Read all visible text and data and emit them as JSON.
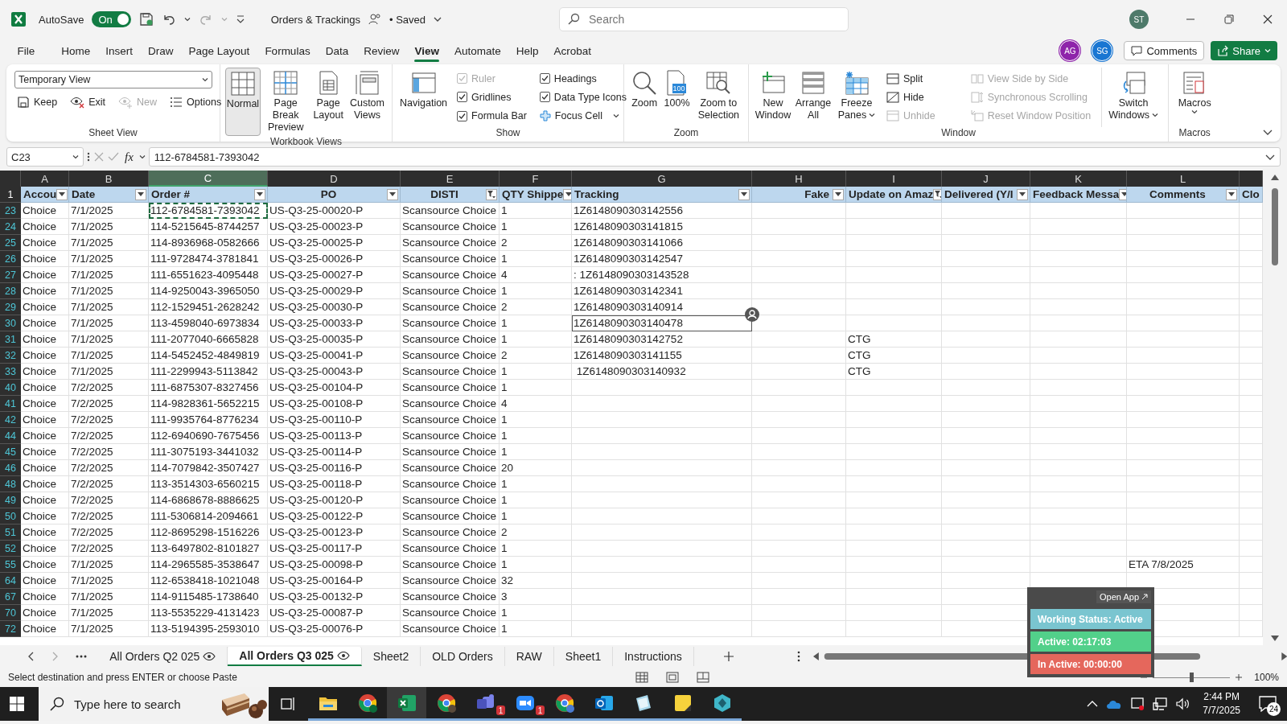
{
  "title_bar": {
    "autosave_label": "AutoSave",
    "autosave": {
      "label": "On",
      "on": true
    },
    "document_title": "Orders & Trackings",
    "save_status": "• Saved",
    "search_placeholder": "Search",
    "user_initials": "ST"
  },
  "menu_tabs": [
    {
      "label": "File",
      "selected": false
    },
    {
      "label": "Home",
      "selected": false
    },
    {
      "label": "Insert",
      "selected": false
    },
    {
      "label": "Draw",
      "selected": false
    },
    {
      "label": "Page Layout",
      "selected": false
    },
    {
      "label": "Formulas",
      "selected": false
    },
    {
      "label": "Data",
      "selected": false
    },
    {
      "label": "Review",
      "selected": false
    },
    {
      "label": "View",
      "selected": true
    },
    {
      "label": "Automate",
      "selected": false
    },
    {
      "label": "Help",
      "selected": false
    },
    {
      "label": "Acrobat",
      "selected": false
    }
  ],
  "collaborators": [
    {
      "initials": "AG",
      "color": "#8e24aa"
    },
    {
      "initials": "SG",
      "color": "#1976d2"
    }
  ],
  "comments_button": "Comments",
  "share_button": "Share",
  "ribbon": {
    "sheet_view": {
      "label": "Sheet View",
      "view": "Temporary View",
      "buttons": [
        {
          "label": "Keep",
          "disabled": false
        },
        {
          "label": "Exit",
          "disabled": false
        },
        {
          "label": "New",
          "disabled": true
        },
        {
          "label": "Options",
          "disabled": false
        }
      ]
    },
    "workbook_views": {
      "label": "Workbook Views",
      "buttons": [
        {
          "label": "Normal",
          "selected": true
        },
        {
          "label": "Page Break Preview",
          "selected": false
        },
        {
          "label": "Page Layout",
          "selected": false
        },
        {
          "label": "Custom Views",
          "selected": false
        }
      ]
    },
    "show": {
      "label": "Show",
      "navigation": "Navigation",
      "checks": [
        {
          "label": "Ruler",
          "checked": true,
          "disabled": true
        },
        {
          "label": "Gridlines",
          "checked": true,
          "disabled": false
        },
        {
          "label": "Formula Bar",
          "checked": true,
          "disabled": false
        },
        {
          "label": "Headings",
          "checked": true,
          "disabled": false
        },
        {
          "label": "Data Type Icons",
          "checked": true,
          "disabled": false
        }
      ],
      "focus_cell": "Focus Cell"
    },
    "zoom": {
      "label": "Zoom",
      "buttons": [
        {
          "label": "Zoom"
        },
        {
          "label": "100%",
          "badge": "100"
        },
        {
          "label": "Zoom to Selection"
        }
      ]
    },
    "window": {
      "label": "Window",
      "large": [
        {
          "label": "New Window",
          "dropdown": false
        },
        {
          "label": "Arrange All",
          "dropdown": false
        },
        {
          "label": "Freeze Panes",
          "dropdown": true
        }
      ],
      "small": [
        {
          "label": "Split",
          "disabled": false
        },
        {
          "label": "Hide",
          "disabled": false
        },
        {
          "label": "Unhide",
          "disabled": true
        }
      ],
      "side": [
        {
          "label": "View Side by Side",
          "disabled": true
        },
        {
          "label": "Synchronous Scrolling",
          "disabled": true
        },
        {
          "label": "Reset Window Position",
          "disabled": true
        }
      ],
      "switch": {
        "label": "Switch Windows",
        "dropdown": true
      }
    },
    "macros": {
      "label": "Macros",
      "button": {
        "label": "Macros",
        "dropdown": true
      }
    }
  },
  "formula_bar": {
    "name_box": "C23",
    "fx": "fx",
    "formula": "112-6784581-7393042"
  },
  "columns": [
    {
      "letter": "A",
      "header": "Accou",
      "filtered": false,
      "selected": false
    },
    {
      "letter": "B",
      "header": "Date",
      "filtered": false,
      "selected": false
    },
    {
      "letter": "C",
      "header": "Order #",
      "filtered": false,
      "selected": true
    },
    {
      "letter": "D",
      "header": "PO",
      "filtered": false,
      "selected": false
    },
    {
      "letter": "E",
      "header": "DISTI",
      "filtered": true,
      "selected": false
    },
    {
      "letter": "F",
      "header": "QTY Shippe",
      "filtered": false,
      "selected": false
    },
    {
      "letter": "G",
      "header": "Tracking",
      "filtered": false,
      "selected": false
    },
    {
      "letter": "H",
      "header": "Fake",
      "filtered": false,
      "selected": false
    },
    {
      "letter": "I",
      "header": "Update on Amaz",
      "filtered": true,
      "selected": false
    },
    {
      "letter": "J",
      "header": "Delivered (Y/I",
      "filtered": false,
      "selected": false
    },
    {
      "letter": "K",
      "header": "Feedback Messa",
      "filtered": false,
      "selected": false
    },
    {
      "letter": "L",
      "header": "Comments",
      "filtered": false,
      "selected": false
    },
    {
      "header": "Clo",
      "selected": false
    }
  ],
  "header_row_number": "1",
  "rows": [
    {
      "number": "23",
      "cells": [
        "Choice",
        "7/1/2025",
        {
          "text": "112-6784581-7393042",
          "copied": true
        },
        "US-Q3-25-00020-P",
        "Scansource Choice",
        "1",
        "1Z6148090303142556"
      ]
    },
    {
      "number": "24",
      "cells": [
        "Choice",
        "7/1/2025",
        "114-5215645-8744257",
        "US-Q3-25-00023-P",
        "Scansource Choice",
        "1",
        "1Z6148090303141815"
      ]
    },
    {
      "number": "25",
      "cells": [
        "Choice",
        "7/1/2025",
        "114-8936968-0582666",
        "US-Q3-25-00025-P",
        "Scansource Choice",
        "2",
        "1Z6148090303141066"
      ]
    },
    {
      "number": "26",
      "cells": [
        "Choice",
        "7/1/2025",
        "111-9728474-3781841",
        "US-Q3-25-00026-P",
        "Scansource Choice",
        "1",
        "1Z6148090303142547"
      ]
    },
    {
      "number": "27",
      "cells": [
        "Choice",
        "7/1/2025",
        "111-6551623-4095448",
        "US-Q3-25-00027-P",
        "Scansource Choice",
        "4",
        ": 1Z6148090303143528"
      ]
    },
    {
      "number": "28",
      "cells": [
        "Choice",
        "7/1/2025",
        "114-9250043-3965050",
        "US-Q3-25-00029-P",
        "Scansource Choice",
        "1",
        "1Z6148090303142341"
      ]
    },
    {
      "number": "29",
      "cells": [
        "Choice",
        "7/1/2025",
        "112-1529451-2628242",
        "US-Q3-25-00030-P",
        "Scansource Choice",
        "2",
        "1Z6148090303140914"
      ]
    },
    {
      "number": "30",
      "cells": [
        "Choice",
        "7/1/2025",
        "113-4598040-6973834",
        "US-Q3-25-00033-P",
        "Scansource Choice",
        "1",
        {
          "text": "1Z6148090303140478",
          "coauthor_selected": true
        }
      ]
    },
    {
      "number": "31",
      "cells": [
        "Choice",
        "7/1/2025",
        "111-2077040-6665828",
        "US-Q3-25-00035-P",
        "Scansource Choice",
        "1",
        "1Z6148090303142752",
        null,
        "CTG"
      ]
    },
    {
      "number": "32",
      "cells": [
        "Choice",
        "7/1/2025",
        "114-5452452-4849819",
        "US-Q3-25-00041-P",
        "Scansource Choice",
        "2",
        "1Z6148090303141155",
        null,
        "CTG"
      ]
    },
    {
      "number": "33",
      "cells": [
        "Choice",
        "7/1/2025",
        "111-2299943-5113842",
        "US-Q3-25-00043-P",
        "Scansource Choice",
        "1",
        " 1Z6148090303140932",
        null,
        "CTG"
      ]
    },
    {
      "number": "40",
      "cells": [
        "Choice",
        "7/2/2025",
        "111-6875307-8327456",
        "US-Q3-25-00104-P",
        "Scansource Choice",
        "1"
      ]
    },
    {
      "number": "41",
      "cells": [
        "Choice",
        "7/2/2025",
        "114-9828361-5652215",
        "US-Q3-25-00108-P",
        "Scansource Choice",
        "4"
      ]
    },
    {
      "number": "42",
      "cells": [
        "Choice",
        "7/2/2025",
        "111-9935764-8776234",
        "US-Q3-25-00110-P",
        "Scansource Choice",
        "1"
      ]
    },
    {
      "number": "44",
      "cells": [
        "Choice",
        "7/2/2025",
        "112-6940690-7675456",
        "US-Q3-25-00113-P",
        "Scansource Choice",
        "1"
      ]
    },
    {
      "number": "45",
      "cells": [
        "Choice",
        "7/2/2025",
        "111-3075193-3441032",
        "US-Q3-25-00114-P",
        "Scansource Choice",
        "1"
      ]
    },
    {
      "number": "46",
      "cells": [
        "Choice",
        "7/2/2025",
        "114-7079842-3507427",
        "US-Q3-25-00116-P",
        "Scansource Choice",
        "20"
      ]
    },
    {
      "number": "48",
      "cells": [
        "Choice",
        "7/2/2025",
        "113-3514303-6560215",
        "US-Q3-25-00118-P",
        "Scansource Choice",
        "1"
      ]
    },
    {
      "number": "49",
      "cells": [
        "Choice",
        "7/2/2025",
        "114-6868678-8886625",
        "US-Q3-25-00120-P",
        "Scansource Choice",
        "1"
      ]
    },
    {
      "number": "50",
      "cells": [
        "Choice",
        "7/2/2025",
        "111-5306814-2094661",
        "US-Q3-25-00122-P",
        "Scansource Choice",
        "1"
      ]
    },
    {
      "number": "51",
      "cells": [
        "Choice",
        "7/2/2025",
        "112-8695298-1516226",
        "US-Q3-25-00123-P",
        "Scansource Choice",
        "2"
      ]
    },
    {
      "number": "52",
      "cells": [
        "Choice",
        "7/2/2025",
        "113-6497802-8101827",
        "US-Q3-25-00117-P",
        "Scansource Choice",
        "1"
      ]
    },
    {
      "number": "55",
      "cells": [
        "Choice",
        "7/1/2025",
        "114-2965585-3538647",
        "US-Q3-25-00098-P",
        "Scansource Choice",
        "1",
        null,
        null,
        null,
        null,
        null,
        "ETA 7/8/2025"
      ]
    },
    {
      "number": "64",
      "cells": [
        "Choice",
        "7/1/2025",
        "112-6538418-1021048",
        "US-Q3-25-00164-P",
        "Scansource Choice",
        "32"
      ]
    },
    {
      "number": "67",
      "cells": [
        "Choice",
        "7/1/2025",
        "114-9115485-1738640",
        "US-Q3-25-00132-P",
        "Scansource Choice",
        "3"
      ]
    },
    {
      "number": "70",
      "cells": [
        "Choice",
        "7/1/2025",
        "113-5535229-4131423",
        "US-Q3-25-00087-P",
        "Scansource Choice",
        "1"
      ]
    },
    {
      "number": "72",
      "cells": [
        "Choice",
        "7/1/2025",
        "113-5194395-2593010",
        "US-Q3-25-00076-P",
        "Scansource Choice",
        "1"
      ]
    }
  ],
  "sheet_tabs": [
    {
      "label": "All Orders Q2 025",
      "selected": false,
      "watched": true
    },
    {
      "label": "All Orders Q3 025",
      "selected": true,
      "watched": true
    },
    {
      "label": "Sheet2",
      "selected": false,
      "watched": false
    },
    {
      "label": "OLD Orders",
      "selected": false,
      "watched": false
    },
    {
      "label": "RAW",
      "selected": false,
      "watched": false
    },
    {
      "label": "Sheet1",
      "selected": false,
      "watched": false
    },
    {
      "label": "Instructions",
      "selected": false,
      "watched": false
    }
  ],
  "status_bar": {
    "message": "Select destination and press ENTER or choose Paste",
    "zoom_slider": {
      "level": 0.5
    },
    "zoom": "100%"
  },
  "tracker_widget": {
    "open_app": "Open App",
    "statuses": [
      {
        "label": "Working Status: Active",
        "color": "#7ac5d0"
      },
      {
        "label": "Active: 02:17:03",
        "color": "#52d08a"
      },
      {
        "label": "In Active: 00:00:00",
        "color": "#e5675c"
      }
    ]
  },
  "taskbar": {
    "search_placeholder": "Type here to search",
    "apps": [
      {
        "running": false,
        "active": false
      },
      {
        "running": true,
        "active": false
      },
      {
        "running": true,
        "active": false
      },
      {
        "running": true,
        "active": true
      },
      {
        "running": true,
        "active": false
      },
      {
        "running": true,
        "active": false,
        "badge": "1"
      },
      {
        "running": true,
        "active": false,
        "badge": "1"
      },
      {
        "running": true,
        "active": false
      },
      {
        "running": true,
        "active": false
      },
      {
        "running": true,
        "active": false
      },
      {
        "running": true,
        "active": false
      },
      {
        "running": true,
        "active": false
      }
    ],
    "time": "2:44 PM",
    "date": "7/7/2025",
    "notifications": "24"
  }
}
